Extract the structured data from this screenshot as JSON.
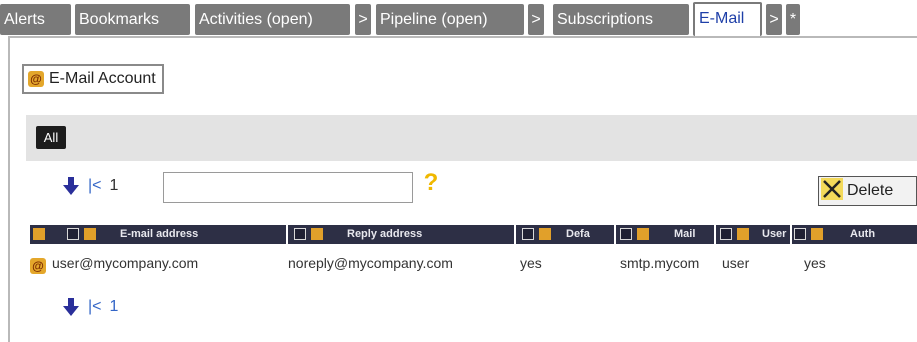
{
  "tabs": [
    {
      "label": "Alerts"
    },
    {
      "label": "Bookmarks"
    },
    {
      "label": "Activities (open)"
    },
    {
      "label": ">"
    },
    {
      "label": "Pipeline (open)"
    },
    {
      "label": ">"
    },
    {
      "label": "Subscriptions"
    },
    {
      "label": "E-Mail"
    },
    {
      "label": ">"
    },
    {
      "label": "*"
    }
  ],
  "active_tab": "E-Mail",
  "account_button": {
    "label": "E-Mail Account",
    "icon": "at-icon"
  },
  "filter": {
    "all_label": "All"
  },
  "pager_top": {
    "first": "|<",
    "page": "1"
  },
  "search": {
    "value": "",
    "placeholder": ""
  },
  "help": {
    "label": "?"
  },
  "delete_button": {
    "label": "Delete"
  },
  "table": {
    "columns": [
      {
        "label": "E-mail address"
      },
      {
        "label": "Reply address"
      },
      {
        "label": "Defa"
      },
      {
        "label": "Mail"
      },
      {
        "label": "User"
      },
      {
        "label": "Auth"
      }
    ],
    "rows": [
      {
        "email": "user@mycompany.com",
        "reply": "noreply@mycompany.com",
        "default": "yes",
        "mail": "smtp.mycom",
        "user": "user",
        "auth": "yes"
      }
    ]
  },
  "pager_bottom": {
    "first": "|<",
    "page": "1"
  },
  "colors": {
    "tab_bg": "#7a7a7a",
    "header_bg": "#2d2f45",
    "accent_orange": "#e1a02a",
    "link_blue": "#3466c7"
  }
}
